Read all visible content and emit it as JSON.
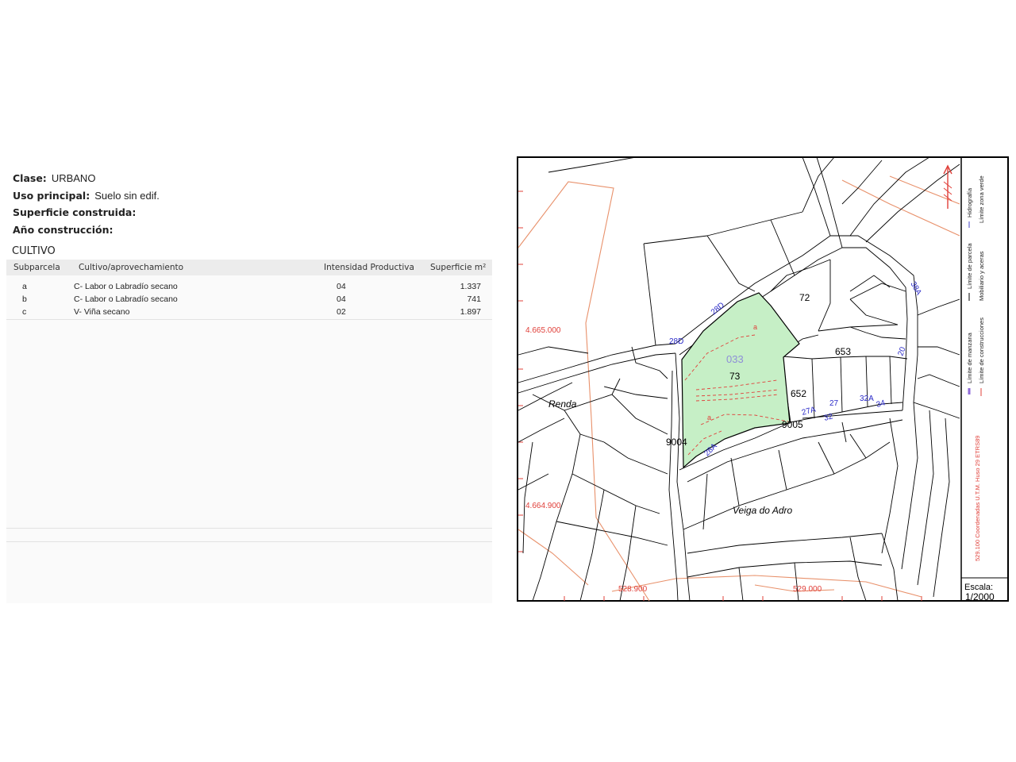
{
  "info": {
    "clase_label": "Clase:",
    "clase_value": "URBANO",
    "uso_label": "Uso principal:",
    "uso_value": "Suelo sin edif.",
    "superficie_label": "Superficie construida:",
    "superficie_value": "",
    "anio_label": "Año construcción:",
    "anio_value": ""
  },
  "cultivo": {
    "title": "CULTIVO",
    "headers": [
      "Subparcela",
      "Cultivo/aprovechamiento",
      "Intensidad Productiva",
      "Superficie m²"
    ],
    "rows": [
      {
        "subparcela": "a",
        "cultivo": "C- Labor o Labradío secano",
        "intensidad": "04",
        "superficie": "1.337"
      },
      {
        "subparcela": "b",
        "cultivo": "C- Labor o Labradío secano",
        "intensidad": "04",
        "superficie": "741"
      },
      {
        "subparcela": "c",
        "cultivo": "V- Viña secano",
        "intensidad": "02",
        "superficie": "1.897"
      }
    ]
  },
  "map": {
    "parcel_numbers": [
      "72",
      "73",
      "653",
      "652",
      "9005",
      "9004"
    ],
    "highlight_ref": "033",
    "place_names": [
      "Renda",
      "Veiga do Adro"
    ],
    "house_numbers": [
      "28D",
      "28D",
      "28A",
      "38A",
      "20",
      "27A",
      "27",
      "32",
      "32A",
      "34"
    ],
    "subparcel_letters": [
      "a",
      "a"
    ],
    "coords_y": [
      "4.665.000",
      "4.664.900"
    ],
    "coords_x": [
      "528.900",
      "529.000"
    ],
    "legend": {
      "limite_manzana": "Límite de manzana",
      "limite_parcela": "Límite de parcela",
      "hidrografia": "Hidrografía",
      "limite_construcciones": "Límite de construcciones",
      "mobiliario": "Mobiliario y aceras",
      "zona_verde": "Límite zona verde",
      "coordenadas": "529.100 Coordenadas U.T.M. Huso 29 ETRS89"
    },
    "scale_label": "Escala:",
    "scale_value": "1/2000",
    "colors": {
      "parcel_fill": "#c6efc6",
      "highlight_ref": "#8e8ed8",
      "house_numbers": "#2a2ac8",
      "coords": "#e0403a",
      "orange_lines": "#e8906a",
      "outline": "#000000"
    }
  }
}
